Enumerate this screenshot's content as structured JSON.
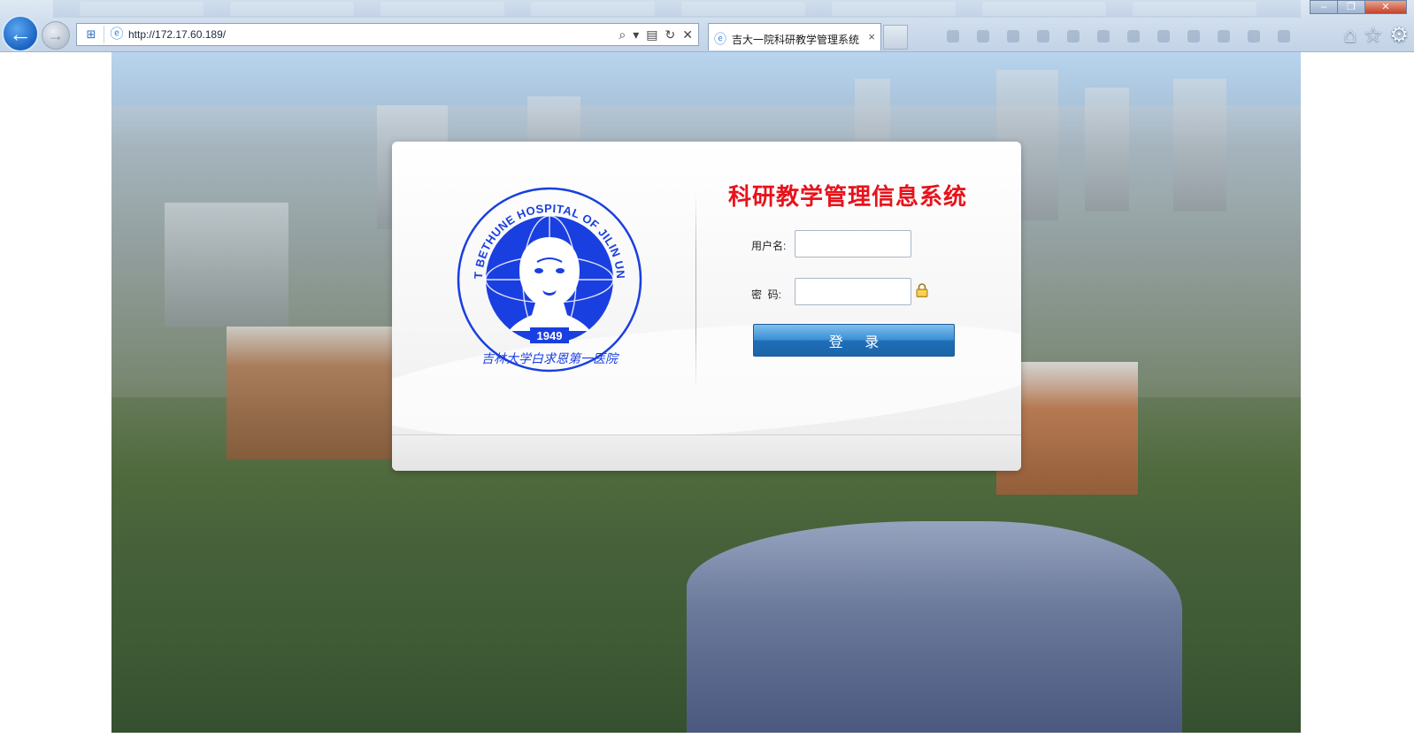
{
  "browser": {
    "url": "http://172.17.60.189/",
    "tab_title": "吉大一院科研教学管理系统",
    "tab_close": "×",
    "back_glyph": "←",
    "forward_glyph": "→",
    "window_controls": {
      "minimize": "–",
      "restore": "❐",
      "close": "✕"
    },
    "toolbar_icons": [
      "search-icon",
      "dropdown-icon",
      "compat-view-icon",
      "refresh-icon",
      "stop-icon"
    ],
    "right_icons": [
      "home-icon",
      "favorites-icon",
      "gear-icon"
    ]
  },
  "login": {
    "system_title": "科研教学管理信息系统",
    "username_label": "用户名:",
    "password_label": "密  码:",
    "username_value": "",
    "password_value": "",
    "submit_label": "登 录",
    "logo": {
      "ring_text": "THE FIRST BETHUNE HOSPITAL OF JILIN UNIVERSITY",
      "bottom_text": "吉林大学白求恩第一医院",
      "year": "1949",
      "color": "#1a3fe0"
    }
  },
  "colors": {
    "title_red": "#e8121b",
    "button_blue": "#2a7cc8",
    "seal_blue": "#1a3fe0"
  }
}
